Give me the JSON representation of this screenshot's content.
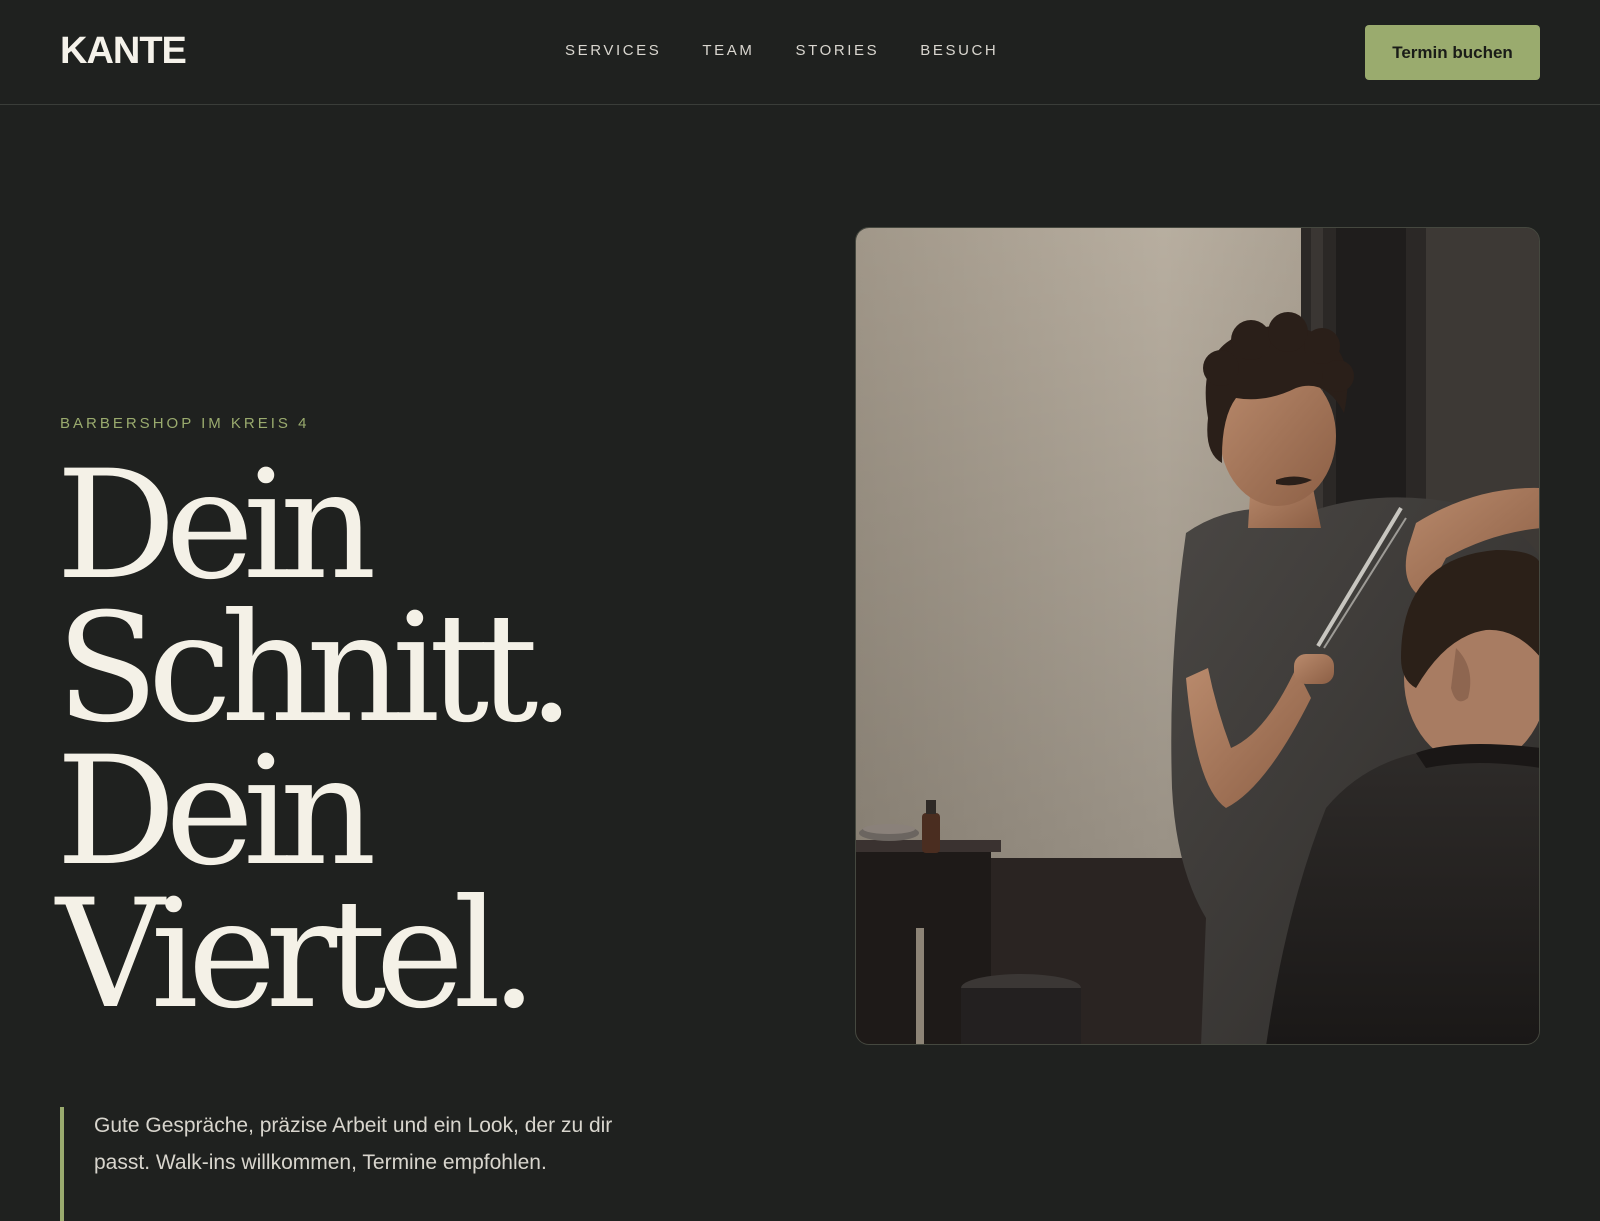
{
  "header": {
    "logo": "KANTE",
    "nav": [
      {
        "label": "SERVICES"
      },
      {
        "label": "TEAM"
      },
      {
        "label": "STORIES"
      },
      {
        "label": "BESUCH"
      }
    ],
    "cta_label": "Termin buchen"
  },
  "hero": {
    "eyebrow": "BARBERSHOP IM KREIS 4",
    "headline_lines": [
      "Dein",
      "Schnitt.",
      "Dein",
      "Viertel."
    ],
    "lead": "Gute Gespräche, präzise Arbeit und ein Look, der zu dir passt. Walk-ins willkommen, Termine empfohlen.",
    "image_subject": "barber-cutting-hair-photo"
  },
  "colors": {
    "background": "#1f211f",
    "accent": "#9aab6e",
    "text": "#f4f1e7"
  }
}
